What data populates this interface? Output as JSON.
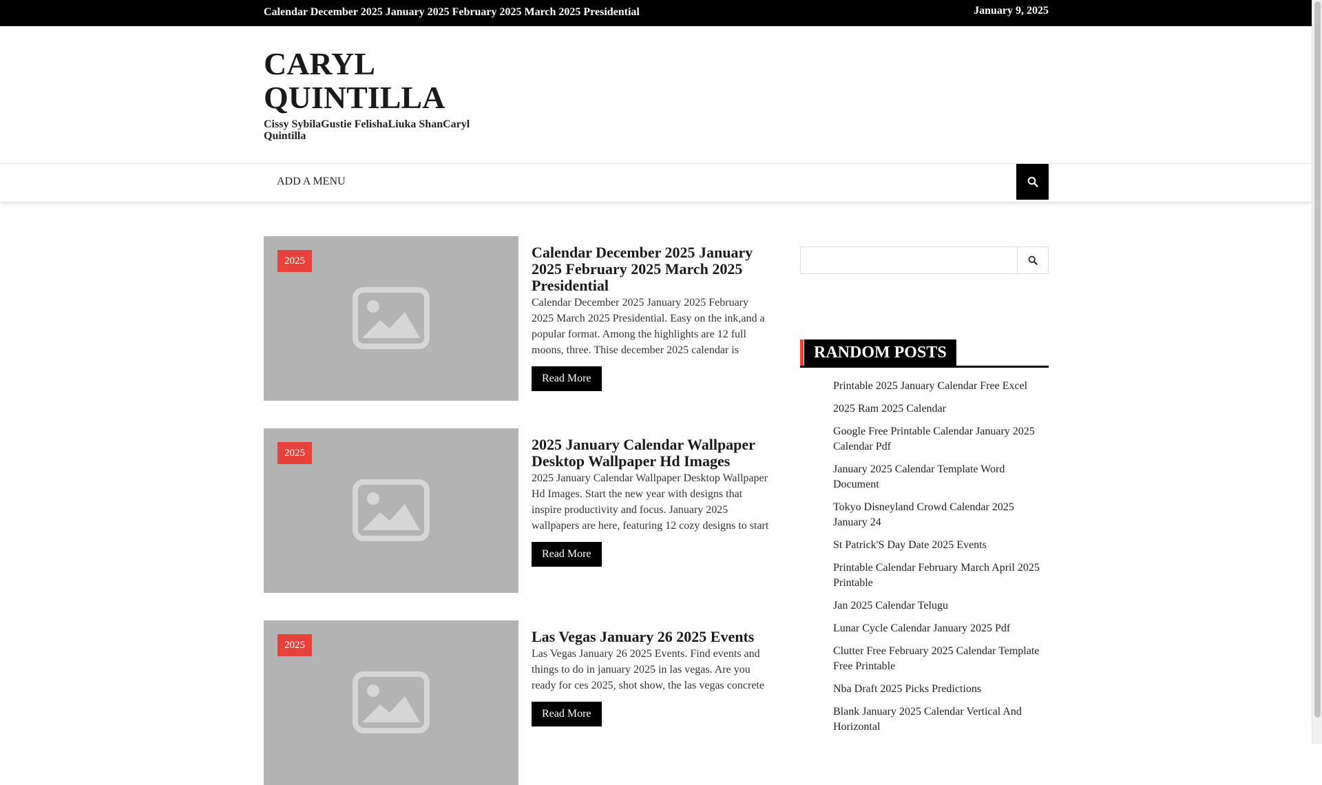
{
  "topbar": {
    "ticker": "Calendar December 2025 January 2025 February 2025 March 2025 Presidential",
    "date": "January 9, 2025"
  },
  "header": {
    "site_title": "CARYL QUINTILLA",
    "tagline": "Cissy SybilaGustie FelishaLiuka ShanCaryl Quintilla"
  },
  "nav": {
    "menu_label": "ADD A MENU",
    "search_icon": "search-icon"
  },
  "posts": [
    {
      "tag": "2025",
      "title": "Calendar December 2025 January 2025 February 2025 March 2025 Presidential",
      "excerpt": "Calendar December 2025 January 2025 February 2025 March 2025 Presidential. Easy on the ink,and a popular format. Among the highlights are 12 full moons, three. Thise december 2025 calendar is",
      "read_more": "Read More"
    },
    {
      "tag": "2025",
      "title": "2025 January Calendar Wallpaper Desktop Wallpaper Hd Images",
      "excerpt": "2025 January Calendar Wallpaper Desktop Wallpaper Hd Images. Start the new year with designs that inspire productivity and focus. January 2025 wallpapers are here, featuring 12 cozy designs to start",
      "read_more": "Read More"
    },
    {
      "tag": "2025",
      "title": "Las Vegas January 26 2025 Events",
      "excerpt": "Las Vegas January 26 2025 Events. Find events and things to do in january 2025 in las vegas. Are you ready for ces 2025, shot show, the las vegas concrete",
      "read_more": "Read More"
    }
  ],
  "sidebar": {
    "search_placeholder": "",
    "random_posts_title": "RANDOM POSTS",
    "random_posts": [
      "Printable 2025 January Calendar Free Excel",
      "2025 Ram 2025 Calendar",
      "Google Free Printable Calendar January 2025 Calendar Pdf",
      "January 2025 Calendar Template Word Document",
      "Tokyo Disneyland Crowd Calendar 2025 January 24",
      "St Patrick'S Day Date 2025 Events",
      "Printable Calendar February March April 2025 Printable",
      "Jan 2025 Calendar Telugu",
      "Lunar Cycle Calendar January 2025 Pdf",
      "Clutter Free February 2025 Calendar Template Free Printable",
      "Nba Draft 2025 Picks Predictions",
      "Blank January 2025 Calendar Vertical And Horizontal"
    ]
  }
}
